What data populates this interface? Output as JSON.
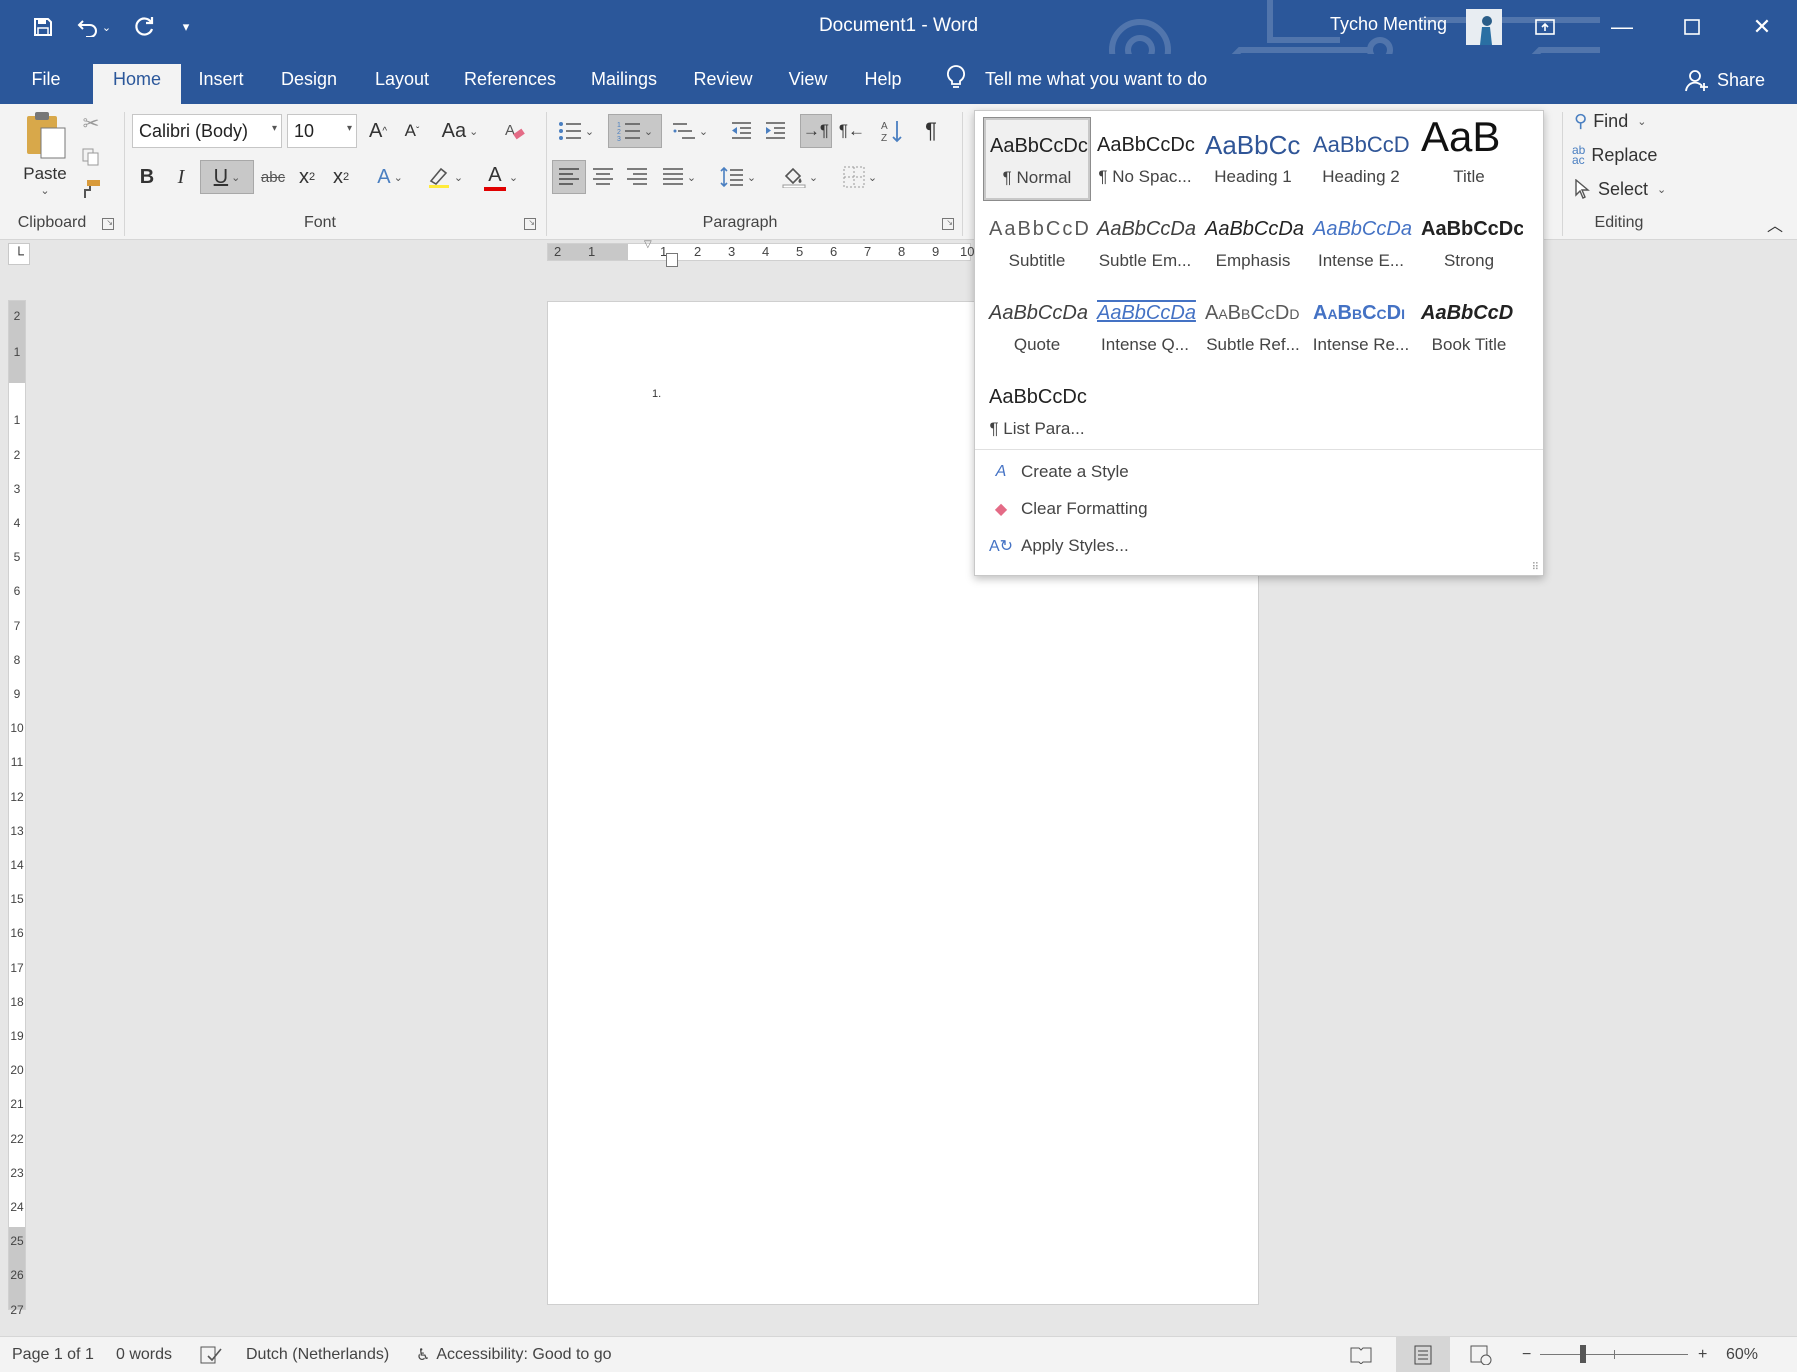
{
  "app": {
    "title": "Document1  -  Word",
    "user": "Tycho Menting"
  },
  "colors": {
    "accent": "#2b579a",
    "ribbon_bg": "#f3f3f3",
    "canvas_bg": "#e6e6e6"
  },
  "qat": {
    "save_icon": "save-icon",
    "undo_icon": "undo-icon",
    "redo_icon": "redo-icon",
    "customize_icon": "customize-qat-icon"
  },
  "tabs": [
    "File",
    "Home",
    "Insert",
    "Design",
    "Layout",
    "References",
    "Mailings",
    "Review",
    "View",
    "Help"
  ],
  "tell_me": "Tell me what you want to do",
  "share": "Share",
  "clipboard": {
    "label": "Clipboard",
    "paste": "Paste"
  },
  "font": {
    "label": "Font",
    "name": "Calibri (Body)",
    "size": "10",
    "grow": "A",
    "shrink": "A",
    "change_case": "Aa",
    "bold": "B",
    "italic": "I",
    "underline": "U",
    "strike": "abc",
    "subscript": "x",
    "superscript": "x",
    "subscript_index": "2",
    "superscript_index": "2",
    "text_effects": "A",
    "font_color": "A"
  },
  "paragraph": {
    "label": "Paragraph"
  },
  "editing": {
    "label": "Editing",
    "find": "Find",
    "replace": "Replace",
    "select": "Select"
  },
  "styles": {
    "items": [
      {
        "preview": "AaBbCcDc",
        "name": "¶ Normal"
      },
      {
        "preview": "AaBbCcDc",
        "name": "¶ No Spac..."
      },
      {
        "preview": "AaBbCc",
        "name": "Heading 1"
      },
      {
        "preview": "AaBbCcD",
        "name": "Heading 2"
      },
      {
        "preview": "AaB",
        "name": "Title"
      },
      {
        "preview": "AaBbCcD",
        "name": "Subtitle"
      },
      {
        "preview": "AaBbCcDa",
        "name": "Subtle Em..."
      },
      {
        "preview": "AaBbCcDa",
        "name": "Emphasis"
      },
      {
        "preview": "AaBbCcDa",
        "name": "Intense E..."
      },
      {
        "preview": "AaBbCcDc",
        "name": "Strong"
      },
      {
        "preview": "AaBbCcDa",
        "name": "Quote"
      },
      {
        "preview": "AaBbCcDa",
        "name": "Intense Q..."
      },
      {
        "preview": "AaBbCcDd",
        "name": "Subtle Ref..."
      },
      {
        "preview": "AaBbCcDi",
        "name": "Intense Re..."
      },
      {
        "preview": "AaBbCcD",
        "name": "Book Title"
      },
      {
        "preview": "AaBbCcDc",
        "name": "¶ List Para..."
      }
    ],
    "menu": [
      {
        "label": "Create a Style",
        "icon": "create-style-icon"
      },
      {
        "label": "Clear Formatting",
        "icon": "clear-formatting-icon"
      },
      {
        "label": "Apply Styles...",
        "icon": "apply-styles-icon"
      }
    ]
  },
  "ruler": {
    "h_ticks": [
      "2",
      "1",
      "1",
      "2",
      "3",
      "4",
      "5",
      "6",
      "7",
      "8",
      "9",
      "10"
    ],
    "v_ticks": [
      "2",
      "1",
      "1",
      "2",
      "3",
      "4",
      "5",
      "6",
      "7",
      "8",
      "9",
      "10",
      "11",
      "12",
      "13",
      "14",
      "15",
      "16",
      "17",
      "18",
      "19",
      "20",
      "21",
      "22",
      "23",
      "24",
      "25",
      "26",
      "27"
    ]
  },
  "document": {
    "list_marker": "1."
  },
  "status": {
    "page": "Page 1 of 1",
    "words": "0 words",
    "language": "Dutch (Netherlands)",
    "accessibility": "Accessibility: Good to go",
    "zoom": "60%",
    "zoom_out": "−",
    "zoom_in": "+"
  }
}
